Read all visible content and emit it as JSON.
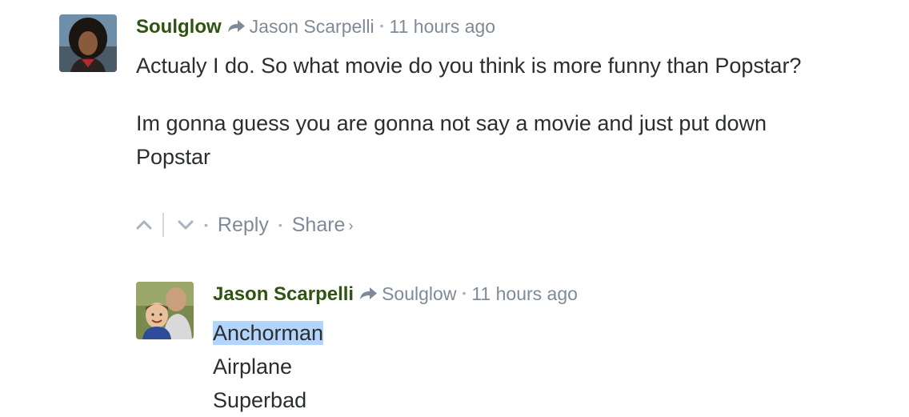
{
  "comments": [
    {
      "author": "Soulglow",
      "reply_to": "Jason Scarpelli",
      "time": "11 hours ago",
      "paragraphs": [
        "Actualy I do. So what movie do you think is more funny than Popstar?",
        "Im gonna guess you are gonna not say a movie and just put down Popstar"
      ],
      "actions": {
        "reply_label": "Reply",
        "share_label": "Share",
        "share_chevron": "›"
      }
    },
    {
      "author": "Jason Scarpelli",
      "reply_to": "Soulglow",
      "time": "11 hours ago",
      "lines": [
        "Anchorman",
        "Airplane",
        "Superbad"
      ]
    }
  ],
  "separator": "•",
  "colors": {
    "author": "#2f5311",
    "meta": "#7f8a99",
    "body": "#2a2e2e",
    "selection": "#b3d4fc"
  },
  "icons": {
    "reply_indicator": "reply-arrow-icon",
    "upvote": "chevron-up-icon",
    "downvote": "chevron-down-icon"
  }
}
